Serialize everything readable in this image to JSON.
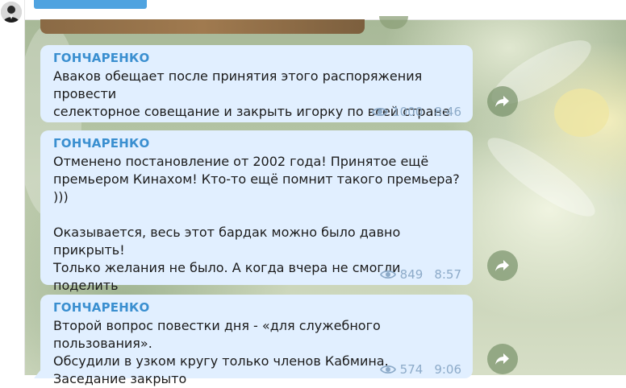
{
  "messages": [
    {
      "sender": "ГОНЧАРЕНКО",
      "text": "Аваков обещает после принятия этого распоряжения провести\nселекторное совещание и закрыть игорку по всей стране",
      "views": "1000",
      "time": "8:46"
    },
    {
      "sender": "ГОНЧАРЕНКО",
      "text": "Отменено постановление от 2002 года! Принятое ещё\nпремьером Кинахом! Кто-то ещё помнит такого премьера? )))\n\nОказывается, весь этот бардак можно было давно прикрыть!\nТолько желания не было. А когда вчера не смогли поделить\nочень большие деньги от лоббистов игорки, глаза-то\nоткрылись",
      "views": "849",
      "time": "8:57"
    },
    {
      "sender": "ГОНЧАРЕНКО",
      "text": "Второй вопрос повестки дня - «для служебного пользования».\nОбсудили в узком кругу только членов Кабмина.\nЗаседание закрыто",
      "views": "574",
      "time": "9:06"
    }
  ],
  "colors": {
    "bubble": "#e1efff",
    "sender": "#3a8fd0",
    "meta": "#8dabc9",
    "top_button": "#4fa3e0"
  },
  "icons": {
    "views": "eye-icon",
    "share": "share-arrow-icon"
  }
}
